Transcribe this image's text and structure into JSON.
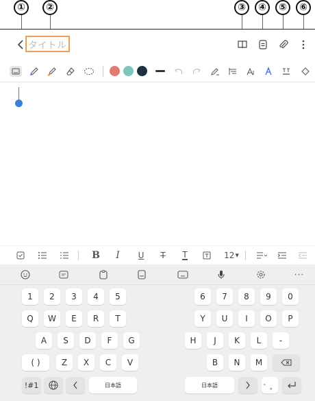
{
  "callouts": [
    "①",
    "②",
    "③",
    "④",
    "⑤",
    "⑥"
  ],
  "note": {
    "title_placeholder": "タイトル"
  },
  "toolbar_icons": [
    "back-icon",
    "read-mode-icon",
    "note-list-icon",
    "attach-icon",
    "more-options-icon"
  ],
  "pen_colors": [
    "#e07a73",
    "#7fc4bd",
    "#1d3142"
  ],
  "format_bar": {
    "font_size": "12"
  },
  "keyboard": {
    "row1": [
      "1",
      "2",
      "3",
      "4",
      "5",
      "6",
      "7",
      "8",
      "9",
      "0"
    ],
    "row2": [
      "Q",
      "W",
      "E",
      "R",
      "T",
      "Y",
      "U",
      "I",
      "O",
      "P"
    ],
    "row3": [
      "A",
      "S",
      "D",
      "F",
      "G",
      "H",
      "J",
      "K",
      "L",
      "-"
    ],
    "row4": [
      "( )",
      "Z",
      "X",
      "C",
      "V",
      "B",
      "N",
      "M"
    ],
    "symbols_label": "!#1",
    "space_label_left": "日本語",
    "space_label_right": "日本語",
    "dakuten_label": "゛。"
  }
}
